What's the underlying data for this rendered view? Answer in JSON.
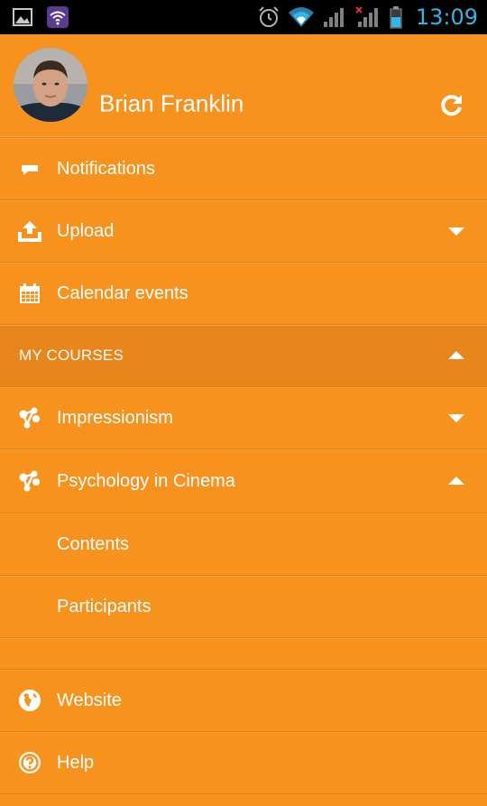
{
  "status_bar": {
    "time": "13:09"
  },
  "profile": {
    "name": "Brian Franklin"
  },
  "menu": {
    "notifications": "Notifications",
    "upload": "Upload",
    "calendar": "Calendar events",
    "my_courses": "MY COURSES",
    "course1": "Impressionism",
    "course2": "Psychology in Cinema",
    "contents": "Contents",
    "participants": "Participants",
    "website": "Website",
    "help": "Help"
  },
  "colors": {
    "background": "#f7921e",
    "section": "#e8861b",
    "status_bar": "#000000",
    "clock": "#33b5e5"
  }
}
